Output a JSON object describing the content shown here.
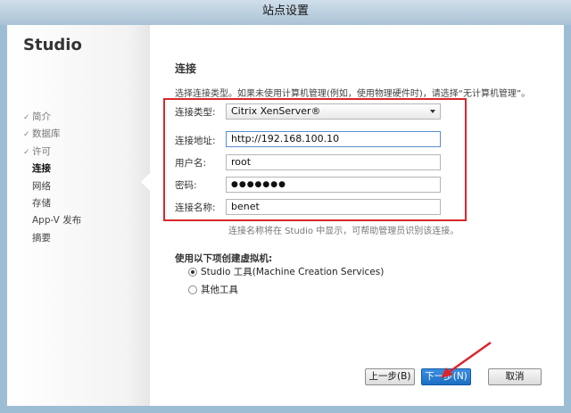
{
  "window": {
    "title": "站点设置"
  },
  "sidebar": {
    "title": "Studio",
    "steps": [
      {
        "label": "简介",
        "state": "done"
      },
      {
        "label": "数据库",
        "state": "done"
      },
      {
        "label": "许可",
        "state": "done"
      },
      {
        "label": "连接",
        "state": "current"
      },
      {
        "label": "网络",
        "state": "pending"
      },
      {
        "label": "存储",
        "state": "pending"
      },
      {
        "label": "App-V 发布",
        "state": "pending"
      },
      {
        "label": "摘要",
        "state": "pending"
      }
    ]
  },
  "main": {
    "title": "连接",
    "description": "选择连接类型。如果未使用计算机管理(例如，使用物理硬件时)，请选择“无计算机管理”。",
    "form": {
      "type_label": "连接类型:",
      "type_value": "Citrix XenServer®",
      "address_label": "连接地址:",
      "address_value": "http://192.168.100.10",
      "username_label": "用户名:",
      "username_value": "root",
      "password_label": "密码:",
      "password_value": "●●●●●●●",
      "name_label": "连接名称:",
      "name_value": "benet",
      "hint": "连接名称将在 Studio 中显示，可帮助管理员识别该连接。"
    },
    "vm_section": {
      "title": "使用以下项创建虚拟机:",
      "option_studio": "Studio 工具(Machine Creation Services)",
      "option_other": "其他工具",
      "selected": "Studio 工具(Machine Creation Services)"
    }
  },
  "buttons": {
    "back": "上一步(B)",
    "next": "下一步(N)",
    "cancel": "取消"
  },
  "colors": {
    "highlight_box": "#d9262b",
    "primary_button": "#1b6fc4",
    "window_frame": "#9dbdd5"
  }
}
